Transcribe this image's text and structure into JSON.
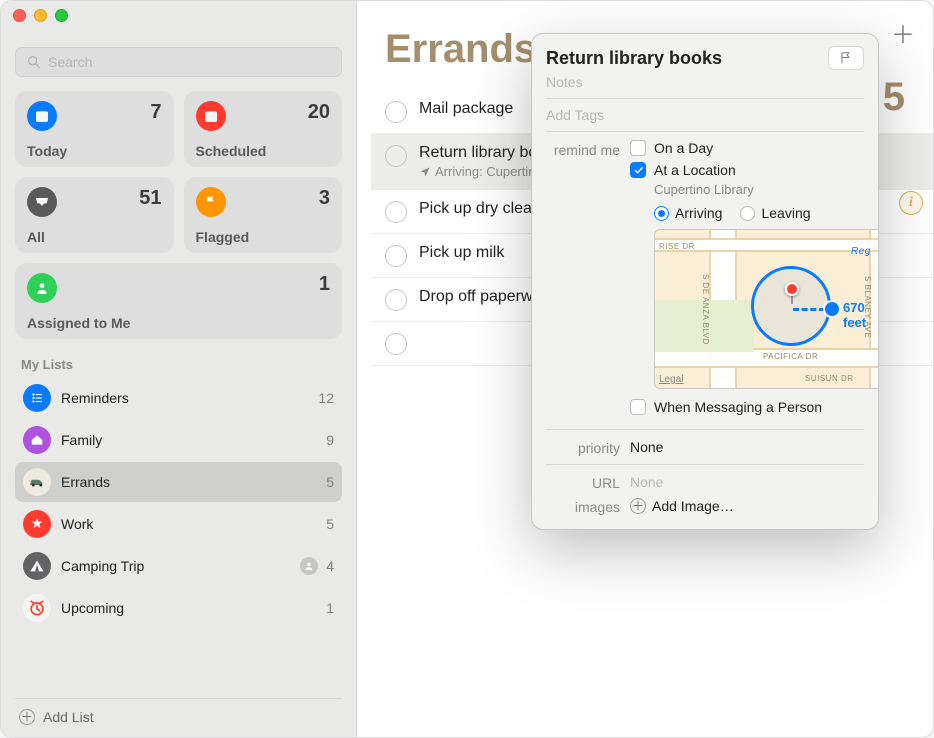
{
  "search": {
    "placeholder": "Search"
  },
  "smart": {
    "today": {
      "label": "Today",
      "count": "7"
    },
    "scheduled": {
      "label": "Scheduled",
      "count": "20"
    },
    "all": {
      "label": "All",
      "count": "51"
    },
    "flagged": {
      "label": "Flagged",
      "count": "3"
    },
    "assigned": {
      "label": "Assigned to Me",
      "count": "1"
    }
  },
  "sidebar": {
    "section": "My Lists",
    "items": [
      {
        "label": "Reminders",
        "count": "12"
      },
      {
        "label": "Family",
        "count": "9"
      },
      {
        "label": "Errands",
        "count": "5"
      },
      {
        "label": "Work",
        "count": "5"
      },
      {
        "label": "Camping Trip",
        "count": "4",
        "shared": true
      },
      {
        "label": "Upcoming",
        "count": "1"
      }
    ],
    "addList": "Add List"
  },
  "main": {
    "title": "Errands",
    "count": "5",
    "tasks": [
      {
        "title": "Mail package"
      },
      {
        "title": "Return library books",
        "sub": "Arriving: Cupertino Library"
      },
      {
        "title": "Pick up dry cleaning"
      },
      {
        "title": "Pick up milk"
      },
      {
        "title": "Drop off paperwork"
      },
      {
        "title": ""
      }
    ]
  },
  "popover": {
    "title": "Return library books",
    "notesPlaceholder": "Notes",
    "tagsPlaceholder": "Add Tags",
    "labels": {
      "remind": "remind me",
      "onADay": "On a Day",
      "atLocation": "At a Location",
      "locationSub": "Cupertino Library",
      "arriving": "Arriving",
      "leaving": "Leaving",
      "radius": "670 feet",
      "legal": "Legal",
      "whenMessaging": "When Messaging a Person",
      "priority": "priority",
      "priorityVal": "None",
      "url": "URL",
      "urlVal": "None",
      "images": "images",
      "addImage": "Add Image…"
    },
    "streets": {
      "rise": "RISE DR",
      "deanza": "S DE ANZA BLVD",
      "pacifica": "PACIFICA DR",
      "blaney": "S BLANEY AVE",
      "suisun": "SUISUN DR",
      "reg": "Reg"
    }
  }
}
